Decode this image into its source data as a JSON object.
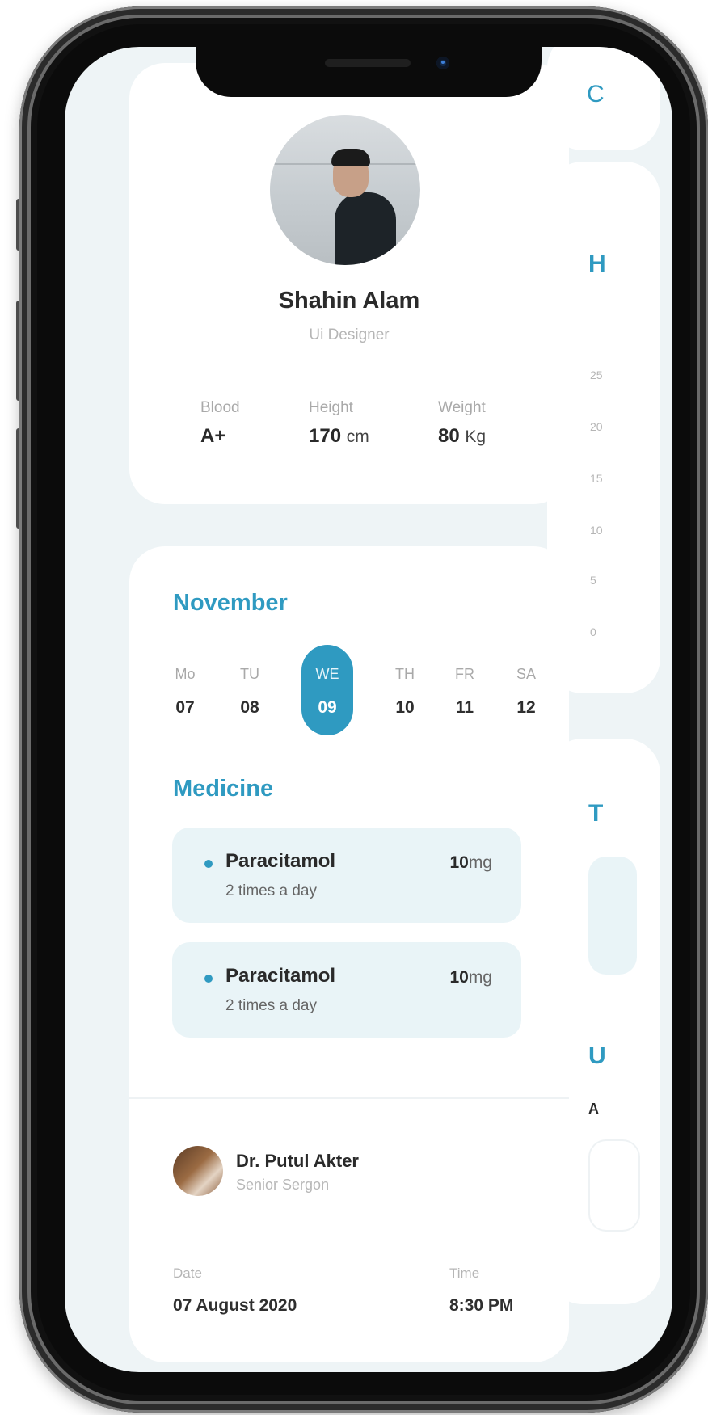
{
  "profile": {
    "name": "Shahin Alam",
    "role": "Ui Designer",
    "stats": [
      {
        "label": "Blood",
        "value": "A+",
        "unit": ""
      },
      {
        "label": "Height",
        "value": "170",
        "unit": "cm"
      },
      {
        "label": "Weight",
        "value": "80",
        "unit": "Kg"
      }
    ]
  },
  "calendar": {
    "month": "November",
    "days": [
      {
        "name": "Mo",
        "num": "07"
      },
      {
        "name": "TU",
        "num": "08"
      },
      {
        "name": "WE",
        "num": "09",
        "active": true
      },
      {
        "name": "TH",
        "num": "10"
      },
      {
        "name": "FR",
        "num": "11"
      },
      {
        "name": "SA",
        "num": "12"
      }
    ]
  },
  "medicine": {
    "title": "Medicine",
    "items": [
      {
        "name": "Paracitamol",
        "frequency": "2 times a day",
        "dose_value": "10",
        "dose_unit": "mg"
      },
      {
        "name": "Paracitamol",
        "frequency": "2 times a day",
        "dose_value": "10",
        "dose_unit": "mg"
      }
    ]
  },
  "appointment": {
    "doctor_name": "Dr. Putul Akter",
    "doctor_role": "Senior Sergon",
    "date_label": "Date",
    "date_value": "07 August 2020",
    "time_label": "Time",
    "time_value": "8:30 PM"
  },
  "peek": {
    "c": "C",
    "h": "H",
    "t": "T",
    "u": "U",
    "a": "A",
    "axis_ticks": [
      "25",
      "20",
      "15",
      "10",
      "5",
      "0"
    ]
  },
  "colors": {
    "accent": "#2f9ac1",
    "screen_bg": "#eef4f6",
    "med_bg": "#e9f4f7"
  }
}
